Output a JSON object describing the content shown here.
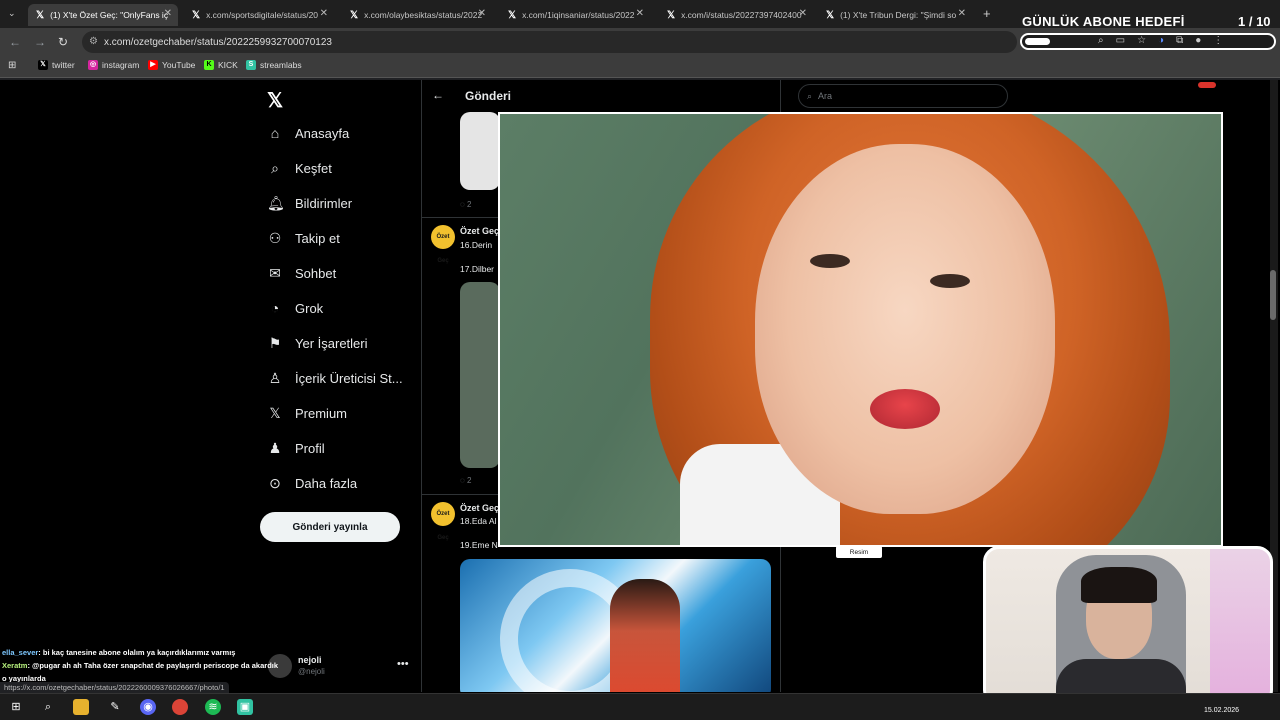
{
  "browser": {
    "tabs": [
      {
        "label": "(1) X'te Özet Geç: \"OnlyFans iç",
        "active": true
      },
      {
        "label": "x.com/sportsdigitale/status/20",
        "active": false
      },
      {
        "label": "x.com/olaybesiktas/status/2022",
        "active": false
      },
      {
        "label": "x.com/1iqinsaniar/status/2022",
        "active": false
      },
      {
        "label": "x.com/i/status/20227397402400",
        "active": false
      },
      {
        "label": "(1) X'te Tribun Dergi: \"Şimdi so",
        "active": false
      }
    ],
    "url": "x.com/ozetgechaber/status/2022259932700070123",
    "bookmarks": [
      {
        "label": "twitter",
        "icon": "x-logo-icon",
        "color": "#000000"
      },
      {
        "label": "instagram",
        "icon": "instagram-icon",
        "color": "#d6249f"
      },
      {
        "label": "YouTube",
        "icon": "youtube-icon",
        "color": "#ff0000"
      },
      {
        "label": "KICK",
        "icon": "kick-icon",
        "color": "#53fc18"
      },
      {
        "label": "streamlabs",
        "icon": "streamlabs-icon",
        "color": "#31c3a2"
      }
    ]
  },
  "overlay": {
    "goal_title": "GÜNLÜK ABONE HEDEFİ",
    "goal_count": "1 / 10",
    "goal_progress": 0.1
  },
  "x": {
    "nav": [
      {
        "label": "Anasayfa",
        "icon": "home-icon"
      },
      {
        "label": "Keşfet",
        "icon": "search-icon"
      },
      {
        "label": "Bildirimler",
        "icon": "bell-icon"
      },
      {
        "label": "Takip et",
        "icon": "follow-icon"
      },
      {
        "label": "Sohbet",
        "icon": "mail-icon"
      },
      {
        "label": "Grok",
        "icon": "grok-icon"
      },
      {
        "label": "Yer İşaretleri",
        "icon": "bookmark-icon"
      },
      {
        "label": "İçerik Üreticisi St...",
        "icon": "creator-icon"
      },
      {
        "label": "Premium",
        "icon": "x-logo-icon"
      },
      {
        "label": "Profil",
        "icon": "profile-icon"
      },
      {
        "label": "Daha fazla",
        "icon": "more-icon"
      }
    ],
    "post_button": "Gönderi yayınla",
    "me": {
      "name": "nejoli",
      "handle": "@nejoli"
    },
    "timeline_title": "Gönderi",
    "search_placeholder": "Ara",
    "tweets": [
      {
        "name": "Özet Geç",
        "line1": "16.Derin",
        "line2": "17.Dilber",
        "replies": "2"
      },
      {
        "name": "Özet Geç",
        "line1": "18.Eda Al",
        "line2": "19.Eme N",
        "replies": "2"
      }
    ],
    "top_replies": "2",
    "avatar_text": "Özet Geç"
  },
  "lightbox": {
    "caption": "Resim"
  },
  "chat": [
    {
      "user": "ella_sever",
      "text": ": bi kaç tanesine abone olalım ya kaçırdıklarımız varmış"
    },
    {
      "user": "Xeratm",
      "text": ": @pugar ah ah Taha özer snapchat de paylaşırdı periscope da akardık o yayınlarda"
    }
  ],
  "status_url": "https://x.com/ozetgechaber/status/2022260009376026667/photo/1",
  "taskbar": {
    "date": "15.02.2026"
  }
}
